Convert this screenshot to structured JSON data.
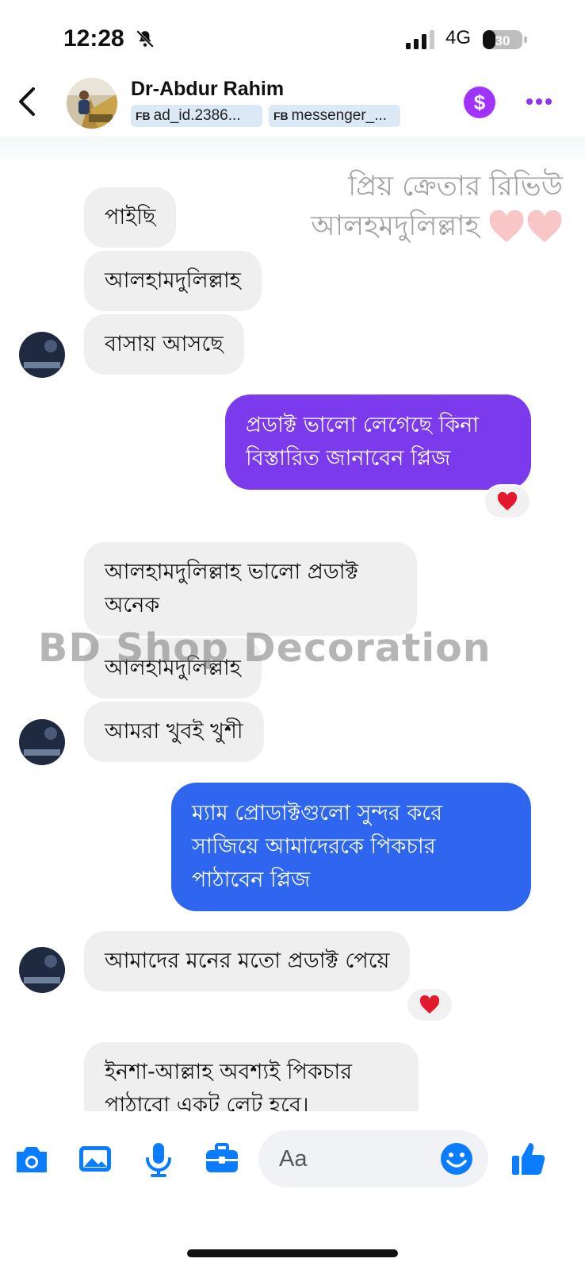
{
  "status": {
    "time": "12:28",
    "network": "4G",
    "battery": "30"
  },
  "header": {
    "name": "Dr-Abdur Rahim",
    "tags": [
      {
        "prefix": "FB",
        "text": "ad_id.2386..."
      },
      {
        "prefix": "FB",
        "text": "messenger_..."
      }
    ]
  },
  "watermark": {
    "caption_line1": "প্রিয় ক্রেতার রিভিউ",
    "caption_line2": "আলহমদুলিল্লাহ",
    "brand": "BD Shop Decoration"
  },
  "messages": [
    {
      "dir": "in",
      "text": "পাইছি"
    },
    {
      "dir": "in",
      "text": "আলহামদুলিল্লাহ"
    },
    {
      "dir": "in",
      "text": "বাসায় আসছে"
    },
    {
      "dir": "out",
      "text": "প্রডাক্ট ভালো লেগেছে কিনা বিস্তারিত জানাবেন প্লিজ",
      "reaction": "heart"
    },
    {
      "dir": "in",
      "text": "আলহামদুলিল্লাহ ভালো প্রডাক্ট অনেক"
    },
    {
      "dir": "in",
      "text": "আলহামদুলিল্লাহ"
    },
    {
      "dir": "in",
      "text": "আমরা খুবই খুশী"
    },
    {
      "dir": "out",
      "text": "ম্যাম প্রোডাক্টগুলো সুন্দর করে সাজিয়ে আমাদেরকে পিকচার পাঠাবেন প্লিজ"
    },
    {
      "dir": "in",
      "text": "আমাদের মনের মতো প্রডাক্ট পেয়ে",
      "reaction": "heart"
    },
    {
      "dir": "in",
      "text": "ইনশা-আল্লাহ অবশ্যই পিকচার পাঠাবো একট লেট হবে।"
    }
  ],
  "composer": {
    "placeholder": "Aa",
    "icons": [
      "camera-icon",
      "image-icon",
      "microphone-icon",
      "briefcase-icon",
      "emoji-icon",
      "thumbs-up-icon"
    ]
  },
  "colors": {
    "accent": "#0a7cff",
    "outgoing_purple": "#7c3aed",
    "outgoing_blue": "#2f66f0",
    "incoming": "#efefef",
    "reaction_heart": "#e3192d",
    "payment": "#a033ff"
  }
}
